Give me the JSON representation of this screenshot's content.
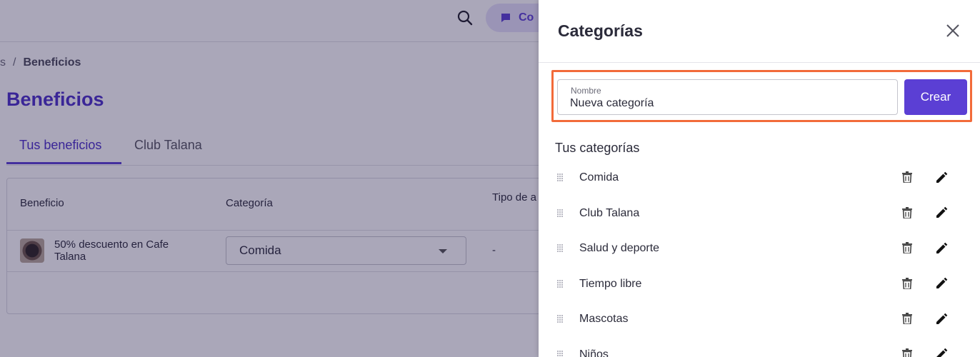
{
  "background": {
    "topbar": {
      "contact_label": "Co"
    },
    "breadcrumb": {
      "parent": "s",
      "separator": "/",
      "current": "Beneficios"
    },
    "page_title": "Beneficios",
    "tabs": [
      {
        "label": "Tus beneficios",
        "active": true
      },
      {
        "label": "Club Talana",
        "active": false
      }
    ],
    "table": {
      "headers": [
        "Beneficio",
        "Categoría",
        "Tipo de a"
      ],
      "rows": [
        {
          "benefit": "50% descuento en Cafe Talana",
          "category": "Comida",
          "type": "-"
        }
      ]
    }
  },
  "panel": {
    "title": "Categorías",
    "form": {
      "name_label": "Nombre",
      "name_value": "Nueva categoría",
      "create_label": "Crear"
    },
    "list_heading": "Tus categorías",
    "categories": [
      {
        "name": "Comida"
      },
      {
        "name": "Club Talana"
      },
      {
        "name": "Salud y deporte"
      },
      {
        "name": "Tiempo libre"
      },
      {
        "name": "Mascotas"
      },
      {
        "name": "Niños"
      }
    ]
  },
  "colors": {
    "brand": "#5b3fd4",
    "highlight": "#f26b3a",
    "overlay": "#201846"
  },
  "icons": {
    "search": "search-icon",
    "chat": "chat-icon",
    "close": "close-icon",
    "drag": "drag-handle-icon",
    "trash": "trash-icon",
    "edit": "pencil-icon",
    "caret": "caret-down-icon"
  }
}
